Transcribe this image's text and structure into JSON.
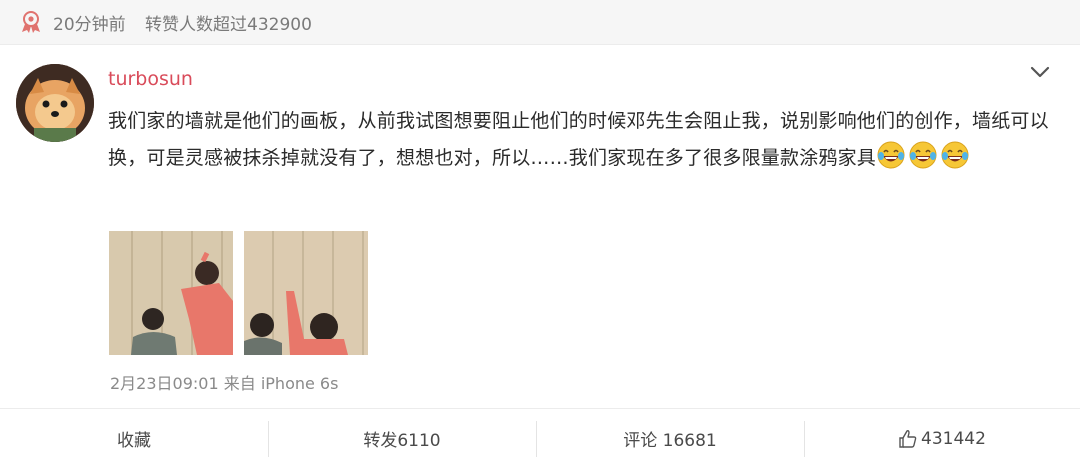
{
  "top_bar": {
    "time": "20分钟前",
    "reposts_stat": "转赞人数超过432900",
    "icon": "hot-badge-icon"
  },
  "post": {
    "username": "turbosun",
    "text_main": "我们家的墙就是他们的画板，从前我试图想要阻止他们的时候邓先生会阻止我，说别影响他们的创作，墙纸可以换，可是灵感被抹杀掉就没有了，想想也对，所以……我们家现在多了很多限量款涂",
    "text_tail": "鸦家具",
    "emoji_count": 3,
    "emoji_icon": "laughing-tears-emoji-icon",
    "timestamp": "2月23日09:01",
    "source": "来自 iPhone 6s",
    "photo_count": 2
  },
  "actions": {
    "favorite": "收藏",
    "repost": "转发6110",
    "comment": "评论 16681",
    "like": "431442"
  },
  "colors": {
    "username": "#d94b5a",
    "top_bar_bg": "#f6f6f6",
    "muted_text": "#7a7a7a"
  }
}
